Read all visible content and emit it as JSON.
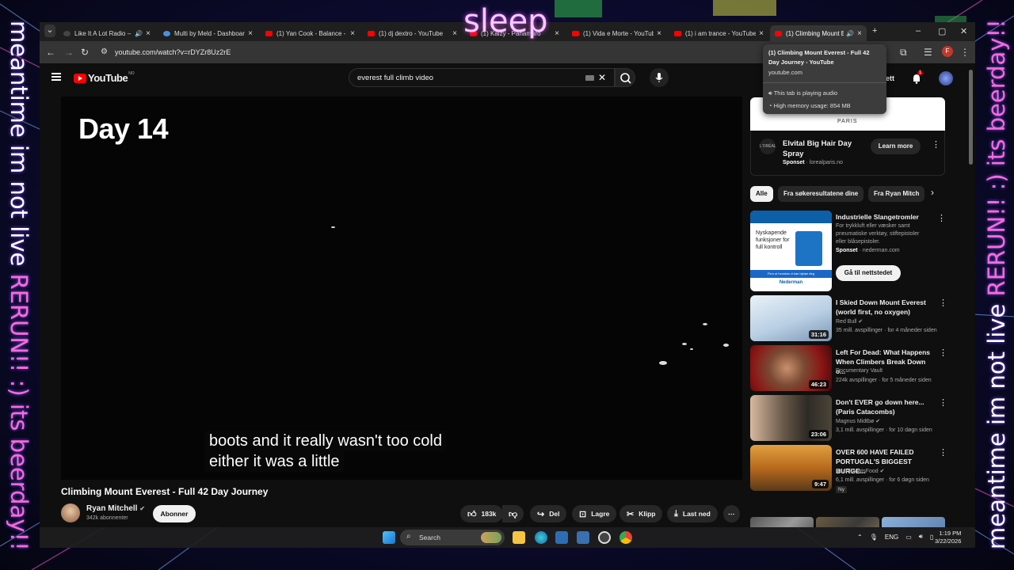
{
  "overlay": {
    "left_white": "meantime im not live ",
    "left_pink": "RERUN!! :) its beerday!!",
    "right_white": "meantime im not live ",
    "right_pink": "RERUN!! :) its beerday!!",
    "top": "sleep"
  },
  "browser": {
    "tabs": [
      {
        "title": "Like It A Lot Radio – T",
        "icon": "dark-favicon",
        "audio": true
      },
      {
        "title": "Multi by Meld - Dashboar",
        "icon": "blue-favicon",
        "audio": false
      },
      {
        "title": "(1) Yan Cook - Balance - Y",
        "icon": "youtube-favicon",
        "audio": false
      },
      {
        "title": "(1) dj dextro - YouTube",
        "icon": "youtube-favicon",
        "audio": false
      },
      {
        "title": "(1) Kaizy - Panamaro",
        "icon": "youtube-favicon",
        "audio": false
      },
      {
        "title": "(1) Vida e Morte - YouTub",
        "icon": "youtube-favicon",
        "audio": false
      },
      {
        "title": "(1) i am trance - YouTube",
        "icon": "youtube-favicon",
        "audio": false
      },
      {
        "title": "(1) Climbing Mount E",
        "icon": "youtube-favicon",
        "audio": true,
        "active": true
      }
    ],
    "url": "youtube.com/watch?v=rDYZr8Uz2rE",
    "profile_initial": "F"
  },
  "hover_card": {
    "title": "(1) Climbing Mount Everest - Full 42 Day Journey - YouTube",
    "host": "youtube.com",
    "audio": "This tab is playing audio",
    "memory": "High memory usage: 854 MB"
  },
  "youtube": {
    "logo": "YouTube",
    "country": "NO",
    "search": "everest full climb video",
    "create_label": "ett",
    "notif_count": "1",
    "player": {
      "overlay_text": "Day 14",
      "caption_line1": "boots and it really wasn't too cold",
      "caption_line2": "either it was a little"
    },
    "video": {
      "title": "Climbing Mount Everest - Full 42 Day Journey",
      "channel": "Ryan Mitchell",
      "subs": "342k abonnenter",
      "subscribe": "Abonner",
      "likes": "183k",
      "share": "Del",
      "save": "Lagre",
      "clip": "Klipp",
      "download": "Last ned"
    },
    "ad": {
      "brand": "PARIS",
      "logo": "L'ORÉAL",
      "title": "Elvital Big Hair Day Spray",
      "sponsored": "Sponset",
      "domain": "lorealparis.no",
      "cta": "Learn more"
    },
    "chips": [
      "Alle",
      "Fra søkeresultatene dine",
      "Fra Ryan Mitch"
    ],
    "sponsored": {
      "title": "Industrielle Slangetromler",
      "desc": "For trykkluft eller væsker samt pneumatiske verktøy, stiftepistoler eller blåsepistoler.",
      "label": "Sponset",
      "domain": "nederman.com",
      "cta": "Gå til nettstedet",
      "thumb_text": "Nyskapende funksjoner for full kontroll",
      "thumb_strip": "Finn ut hvordan vi kan hjelpe deg",
      "thumb_brand": "Nederman"
    },
    "recs": [
      {
        "title": "I Skied Down Mount Everest (world first, no oxygen)",
        "channel": "Red Bull",
        "meta": "35 mill. avspillinger · for 4 måneder siden",
        "duration": "31:16"
      },
      {
        "title": "Left For Dead: What Happens When Climbers Break Down o...",
        "channel": "Documentary Vault",
        "meta": "224k avspillinger · for 5 måneder siden",
        "duration": "46:23"
      },
      {
        "title": "Don't EVER go down here... (Paris Catacombs)",
        "channel": "Magnus Midtbø",
        "meta": "3,1 mill. avspillinger · for 10 døgn siden",
        "duration": "23:06"
      },
      {
        "title": "OVER 600 HAVE FAILED PORTUGAL'S BIGGEST BURGE...",
        "channel": "BeardMeatsFood",
        "meta": "6,1 mill. avspillinger · for 6 døgn siden",
        "duration": "9:47",
        "badge": "Ny"
      }
    ]
  },
  "taskbar": {
    "search": "Search",
    "lang": "ENG",
    "time": "1:19 PM",
    "date": "3/22/2026"
  },
  "colors": {
    "yt_red": "#ff0000",
    "overlay_pink": "#ff6ad5",
    "bg": "#0f0f0f"
  }
}
